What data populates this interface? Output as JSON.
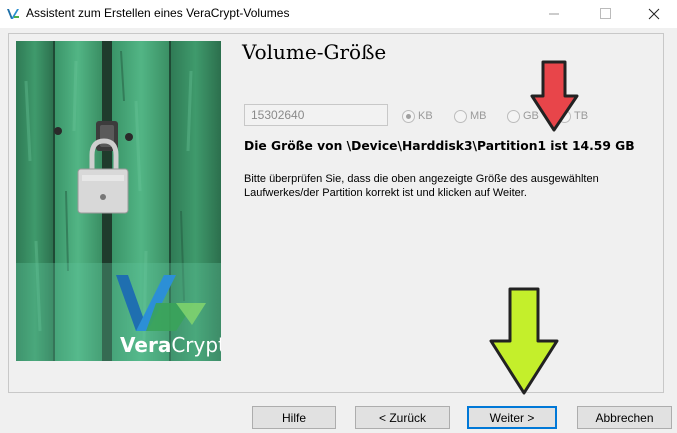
{
  "window": {
    "title": "Assistent zum Erstellen eines VeraCrypt-Volumes",
    "icon": "veracrypt-logo-icon"
  },
  "side_image": {
    "brand": "VeraCrypt",
    "brand_prefix": "Vera",
    "brand_suffix": "Crypt",
    "icon": "padlock-on-green-door"
  },
  "page": {
    "heading": "Volume-Größe",
    "size_value": "15302640",
    "units": [
      {
        "label": "KB",
        "selected": true
      },
      {
        "label": "MB",
        "selected": false
      },
      {
        "label": "GB",
        "selected": false
      },
      {
        "label": "TB",
        "selected": false
      }
    ],
    "size_info": "Die Größe von \\Device\\Harddisk3\\Partition1 ist 14.59 GB",
    "hint": "Bitte überprüfen Sie, dass die oben angezeigte Größe des ausgewählten Laufwerkes/der Partition korrekt ist und klicken auf Weiter."
  },
  "buttons": {
    "help": "Hilfe",
    "back": "< Zurück",
    "next": "Weiter >",
    "cancel": "Abbrechen"
  },
  "annotations": {
    "red_arrow_color": "#e8454a",
    "green_arrow_color": "#c4ef2b"
  }
}
